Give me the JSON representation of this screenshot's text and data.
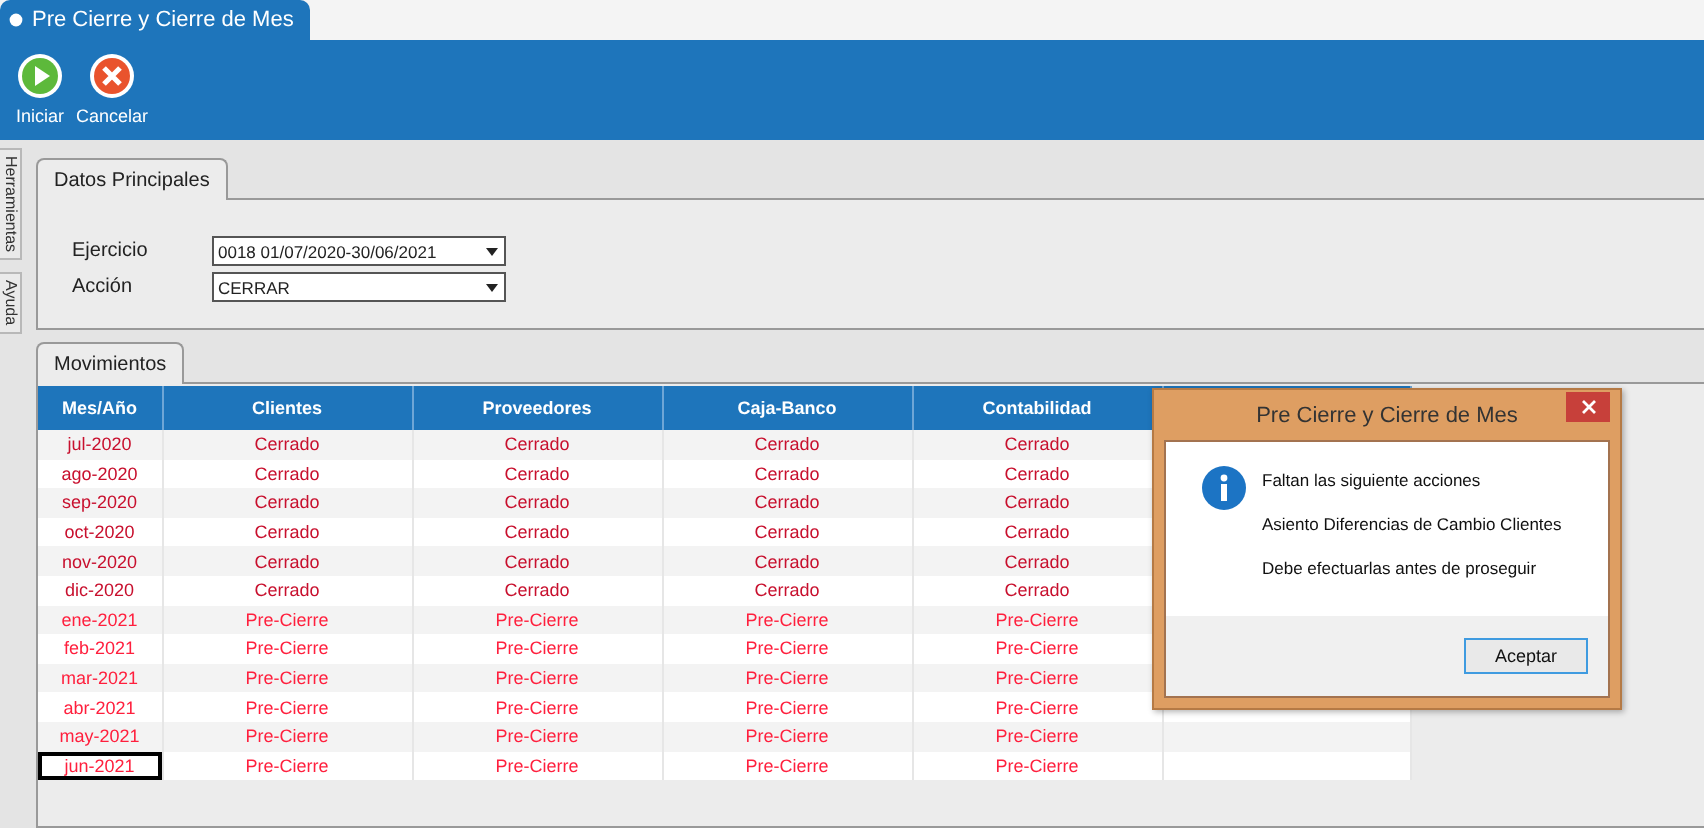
{
  "window": {
    "tab_title": "Pre Cierre y Cierre de Mes"
  },
  "toolbar": [
    {
      "label": "Iniciar",
      "kind": "start"
    },
    {
      "label": "Cancelar",
      "kind": "cancel"
    }
  ],
  "side_tabs": [
    "Herramientas",
    "Ayuda"
  ],
  "main_panel": {
    "tab": "Datos Principales",
    "fields": [
      {
        "label": "Ejercicio",
        "value": "0018 01/07/2020-30/06/2021"
      },
      {
        "label": "Acción",
        "value": "CERRAR"
      }
    ]
  },
  "movements": {
    "tab": "Movimientos",
    "columns": [
      "Mes/Año",
      "Clientes",
      "Proveedores",
      "Caja-Banco",
      "Contabilidad"
    ],
    "rows": [
      {
        "kind": "closed",
        "selected": false,
        "cells": [
          "jul-2020",
          "Cerrado",
          "Cerrado",
          "Cerrado",
          "Cerrado"
        ]
      },
      {
        "kind": "closed",
        "selected": false,
        "cells": [
          "ago-2020",
          "Cerrado",
          "Cerrado",
          "Cerrado",
          "Cerrado"
        ]
      },
      {
        "kind": "closed",
        "selected": false,
        "cells": [
          "sep-2020",
          "Cerrado",
          "Cerrado",
          "Cerrado",
          "Cerrado"
        ]
      },
      {
        "kind": "closed",
        "selected": false,
        "cells": [
          "oct-2020",
          "Cerrado",
          "Cerrado",
          "Cerrado",
          "Cerrado"
        ]
      },
      {
        "kind": "closed",
        "selected": false,
        "cells": [
          "nov-2020",
          "Cerrado",
          "Cerrado",
          "Cerrado",
          "Cerrado"
        ]
      },
      {
        "kind": "closed",
        "selected": false,
        "cells": [
          "dic-2020",
          "Cerrado",
          "Cerrado",
          "Cerrado",
          "Cerrado"
        ]
      },
      {
        "kind": "pre",
        "selected": false,
        "cells": [
          "ene-2021",
          "Pre-Cierre",
          "Pre-Cierre",
          "Pre-Cierre",
          "Pre-Cierre"
        ]
      },
      {
        "kind": "pre",
        "selected": false,
        "cells": [
          "feb-2021",
          "Pre-Cierre",
          "Pre-Cierre",
          "Pre-Cierre",
          "Pre-Cierre"
        ]
      },
      {
        "kind": "pre",
        "selected": false,
        "cells": [
          "mar-2021",
          "Pre-Cierre",
          "Pre-Cierre",
          "Pre-Cierre",
          "Pre-Cierre"
        ]
      },
      {
        "kind": "pre",
        "selected": false,
        "cells": [
          "abr-2021",
          "Pre-Cierre",
          "Pre-Cierre",
          "Pre-Cierre",
          "Pre-Cierre"
        ]
      },
      {
        "kind": "pre",
        "selected": false,
        "cells": [
          "may-2021",
          "Pre-Cierre",
          "Pre-Cierre",
          "Pre-Cierre",
          "Pre-Cierre"
        ]
      },
      {
        "kind": "pre",
        "selected": true,
        "cells": [
          "jun-2021",
          "Pre-Cierre",
          "Pre-Cierre",
          "Pre-Cierre",
          "Pre-Cierre"
        ]
      }
    ]
  },
  "dialog": {
    "title": "Pre Cierre y Cierre de Mes",
    "lines": [
      "Faltan las siguiente acciones",
      "Asiento Diferencias de Cambio Clientes",
      "Debe efectuarlas antes de proseguir"
    ],
    "button": "Aceptar"
  }
}
